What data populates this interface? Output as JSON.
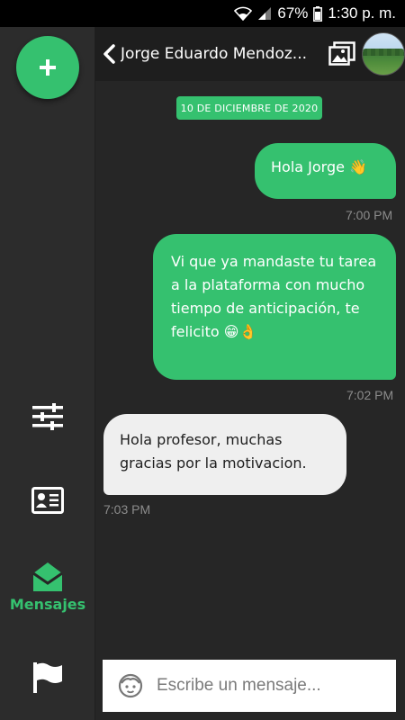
{
  "status_bar": {
    "battery": "67%",
    "time": "1:30 p. m."
  },
  "header": {
    "contact_name": "Jorge Eduardo Mendoz..."
  },
  "sidebar": {
    "messages_label": "Mensajes"
  },
  "chat": {
    "date_chip": "10 DE DICIEMBRE DE 2020",
    "messages": [
      {
        "direction": "outgoing",
        "text": "Hola Jorge 👋",
        "time": "7:00 PM"
      },
      {
        "direction": "outgoing",
        "text": "Vi que ya mandaste tu tarea a la plataforma con mucho tiempo de anticipación, te felicito 😁👌",
        "time": "7:02 PM"
      },
      {
        "direction": "incoming",
        "text": "Hola profesor, muchas gracias por la motivacion.",
        "time": "7:03 PM"
      }
    ]
  },
  "composer": {
    "placeholder": "Escribe un mensaje..."
  },
  "colors": {
    "accent": "#35c16f",
    "background": "#262626",
    "header": "#1e1e1e",
    "incoming_bubble": "#efefef"
  }
}
